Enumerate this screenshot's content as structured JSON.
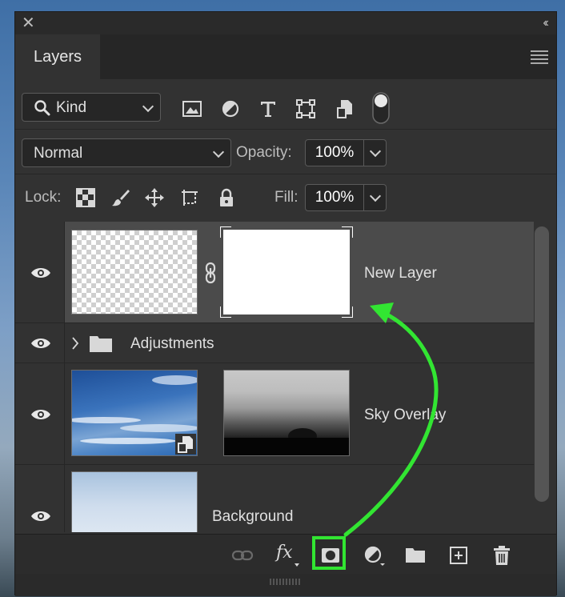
{
  "panel": {
    "tab_label": "Layers",
    "close_glyph": "✕",
    "collapse_glyph": "‹‹"
  },
  "filter": {
    "kind_label": "Kind",
    "icons": [
      "image-filter-icon",
      "adjustment-filter-icon",
      "type-filter-icon",
      "shape-filter-icon",
      "smart-object-filter-icon",
      "filter-toggle-icon"
    ]
  },
  "blend": {
    "mode": "Normal",
    "opacity_label": "Opacity:",
    "opacity_value": "100%"
  },
  "lock": {
    "label": "Lock:",
    "icons": [
      "lock-transparent-pixels-icon",
      "lock-image-pixels-icon",
      "lock-position-icon",
      "lock-artboard-icon",
      "lock-all-icon"
    ],
    "fill_label": "Fill:",
    "fill_value": "100%"
  },
  "layers": [
    {
      "name": "New Layer",
      "selected": true,
      "visible": true
    },
    {
      "name": "Adjustments",
      "type": "group",
      "visible": true
    },
    {
      "name": "Sky Overlay",
      "visible": true,
      "smart_object": true
    },
    {
      "name": "Background",
      "visible": true
    }
  ],
  "footer": {
    "icons": [
      "link-layers-icon",
      "fx-icon",
      "add-mask-icon",
      "new-adjustment-icon",
      "new-group-icon",
      "new-layer-icon",
      "delete-icon"
    ],
    "fx_label": "fx",
    "highlight_color": "#32e532"
  },
  "colors": {
    "panel_bg": "#323232",
    "selected_row": "#4b4b4b",
    "annotation": "#32e532"
  }
}
